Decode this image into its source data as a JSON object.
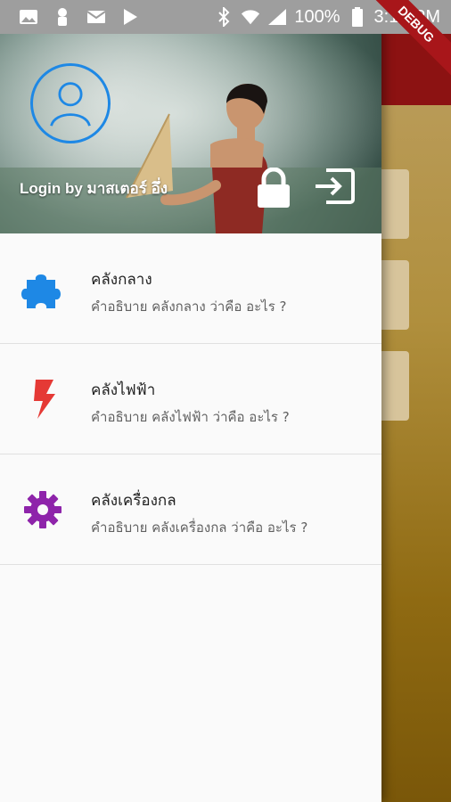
{
  "status_bar": {
    "battery_text": "100%",
    "time": "3:12 PM",
    "icons": [
      "gallery-icon",
      "person-icon",
      "mail-icon",
      "play-store-icon",
      "bluetooth-icon",
      "wifi-icon",
      "signal-icon",
      "battery-icon"
    ]
  },
  "debug_banner": "DEBUG",
  "drawer": {
    "header": {
      "login_text": "Login by มาสเตอร์ อึ่ง",
      "avatar_icon": "account-circle-icon",
      "lock_icon": "lock-icon",
      "logout_icon": "exit-to-app-icon"
    },
    "menu": [
      {
        "title": "คลังกลาง",
        "subtitle": "คำอธิบาย คลังกลาง ว่าคือ อะไร ?",
        "icon": "puzzle-icon",
        "color": "#1e88e5"
      },
      {
        "title": "คลังไฟฟ้า",
        "subtitle": "คำอธิบาย คลังไฟฟ้า ว่าคือ อะไร ?",
        "icon": "flash-icon",
        "color": "#e53935"
      },
      {
        "title": "คลังเครื่องกล",
        "subtitle": "คำอธิบาย คลังเครื่องกล ว่าคือ อะไร ?",
        "icon": "gear-icon",
        "color": "#8e24aa"
      }
    ]
  },
  "colors": {
    "appbar": "#8c1212",
    "avatar_ring": "#1e88e5"
  }
}
